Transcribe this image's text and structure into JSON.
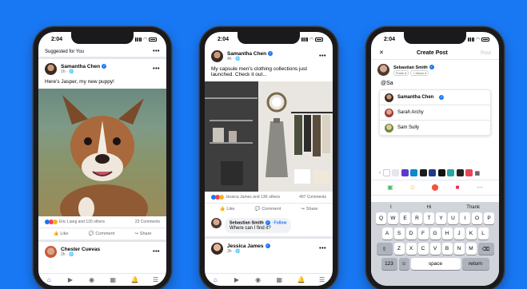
{
  "statusbar": {
    "time": "2:04"
  },
  "phone1": {
    "suggested_label": "Suggested for You",
    "post": {
      "author": "Samantha Chen",
      "meta": "1h · 🌐",
      "text": "Here's Jasper, my new puppy!",
      "reactions_text": "Eric Liang and 120 others",
      "comments_count": "23 Comments"
    },
    "actions": {
      "like": "Like",
      "comment": "Comment",
      "share": "Share"
    },
    "next_post": {
      "author": "Chester Cuevas",
      "meta": "2h · 🌐"
    }
  },
  "phone2": {
    "post": {
      "author": "Samantha Chen",
      "meta": "4h · 🌐",
      "text": "My capsule men's clothing collections just launched. Check it out...",
      "reactions_text": "Jessica James and 13K others",
      "comments_count": "497 Comments"
    },
    "actions": {
      "like": "Like",
      "comment": "Comment",
      "share": "Share"
    },
    "comment": {
      "author": "Sebastian Smith",
      "follow": "Follow",
      "text": "Where can I find it?"
    },
    "next_post": {
      "author": "Jessica James",
      "meta": "3h · 🌐"
    }
  },
  "phone3": {
    "header": {
      "close": "✕",
      "title": "Create Post",
      "post": "Post"
    },
    "composer": {
      "author": "Sebastian Smith",
      "audience_chip": "Public ▾",
      "album_chip": "+ Album ▾",
      "input_text": "@Sa"
    },
    "mentions": [
      {
        "name": "Samantha Chen",
        "verified": true
      },
      {
        "name": "Sarah Archy",
        "verified": false
      },
      {
        "name": "Sam Sully",
        "verified": false
      }
    ],
    "keyboard": {
      "suggestions": [
        "I",
        "Hi",
        "Thank"
      ],
      "row1": [
        "Q",
        "W",
        "E",
        "R",
        "T",
        "Y",
        "U",
        "I",
        "O",
        "P"
      ],
      "row2": [
        "A",
        "S",
        "D",
        "F",
        "G",
        "H",
        "J",
        "K",
        "L"
      ],
      "row3": [
        "Z",
        "X",
        "C",
        "V",
        "B",
        "N",
        "M"
      ],
      "num_key": "123",
      "space_key": "space",
      "return_key": "return"
    }
  },
  "colors": {
    "brand": "#1877f2",
    "bg": "#1877f2"
  }
}
